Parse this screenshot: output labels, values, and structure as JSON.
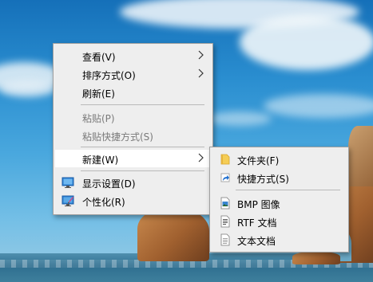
{
  "context_menu": {
    "items": [
      {
        "label": "查看(V)",
        "has_submenu": true
      },
      {
        "label": "排序方式(O)",
        "has_submenu": true
      },
      {
        "label": "刷新(E)"
      },
      {
        "label": "粘贴(P)",
        "disabled": true
      },
      {
        "label": "粘贴快捷方式(S)",
        "disabled": true
      },
      {
        "label": "新建(W)",
        "has_submenu": true,
        "highlighted": true
      },
      {
        "label": "显示设置(D)",
        "icon": "display-settings-icon"
      },
      {
        "label": "个性化(R)",
        "icon": "personalize-icon"
      }
    ]
  },
  "new_submenu": {
    "items": [
      {
        "label": "文件夹(F)",
        "icon": "folder-icon"
      },
      {
        "label": "快捷方式(S)",
        "icon": "shortcut-icon"
      },
      {
        "label": "BMP 图像",
        "icon": "bmp-image-icon"
      },
      {
        "label": "RTF 文档",
        "icon": "rtf-document-icon"
      },
      {
        "label": "文本文档",
        "icon": "text-document-icon"
      }
    ]
  },
  "colors": {
    "menu_background": "#eeeeee",
    "menu_border": "#a0a0a0",
    "highlight": "#ffffff",
    "disabled_text": "#7a7a7a",
    "folder_yellow": "#f5cd55",
    "shortcut_blue": "#1e6fd0"
  }
}
